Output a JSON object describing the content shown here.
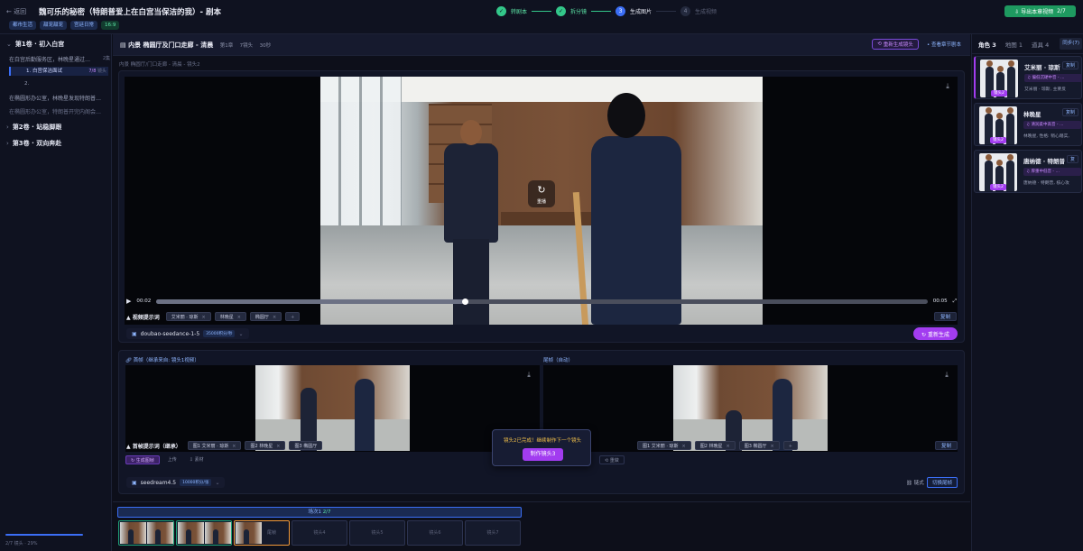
{
  "header": {
    "back_label": "← 返回",
    "title": "魏可乐的秘密（特朗普爱上在白宫当保洁的我）- 剧本",
    "tags": [
      "都市生活",
      "甜宠甜宠",
      "宫廷日常",
      "16:9"
    ],
    "steps": [
      {
        "label": "转剧本",
        "state": "done",
        "icon": "check-icon"
      },
      {
        "label": "拆分镜",
        "state": "done",
        "icon": "check-icon"
      },
      {
        "label": "生成图片",
        "state": "active",
        "number": "3"
      },
      {
        "label": "生成视频",
        "state": "todo",
        "number": "4"
      }
    ],
    "export_label": "⇩ 导出本章视频",
    "export_count": "2/7"
  },
  "sidebar": {
    "volumes": [
      {
        "label": "第1卷 · 初入白宫",
        "expanded": true
      },
      {
        "label": "第2卷 · 站稳脚跟",
        "expanded": false
      },
      {
        "label": "第3卷 · 双向奔赴",
        "expanded": false
      }
    ],
    "episodes": [
      {
        "label": "在白宫后勤服务区，林晚星通过…",
        "count": "2集"
      },
      {
        "label": "在椭圆形办公室，林晚星发现特朗普…"
      },
      {
        "label": "在椭圆形办公室，特朗普开完内阁会…"
      }
    ],
    "subitems": [
      {
        "label": "1. 白宫保洁面试",
        "count_done": "7/8",
        "count_label": "镜头",
        "selected": true
      },
      {
        "label": "2.",
        "selected": false
      }
    ],
    "progress_text": "2/7 镜头 · 29%"
  },
  "scene": {
    "title": "内景 椭圆厅及门口走廊 - 清晨",
    "meta": [
      "第1章",
      "7镜头",
      "30秒"
    ],
    "regen_all_label": "重新生成镜头",
    "view_script_label": "• 查看章节剧本",
    "breadcrumb": "内景 椭圆厅/门口走廊 - 清晨 - 镜头2"
  },
  "video": {
    "replay_label": "重播",
    "current_time": "00:02",
    "duration": "00:05",
    "progress": 0.4,
    "prompt_label": "视频提示词",
    "chips": [
      "艾米丽 · 琼斯",
      "林晚星",
      "椭圆厅"
    ],
    "copy_label": "复制",
    "model": "doubao-seedance-1-5",
    "model_price": "35000积分/秒",
    "regen_label": "↻ 重新生成"
  },
  "frames": {
    "first_label": "首帧（继承来自: 镜头1视频）",
    "last_label": "尾帧（自动）",
    "first_prompt_label": "首帧提示词（继承）",
    "first_chips": [
      "图1 艾米丽 · 琼斯",
      "图2 林晚星",
      "图3 椭圆厅"
    ],
    "last_chips": [
      "图1 艾米丽 · 琼斯",
      "图2 林晚星",
      "图3 椭圆厅"
    ],
    "copy_label": "复制",
    "action_buttons": [
      "↻ 生成图帧",
      "上传",
      "⇩ 素材"
    ],
    "reset_label": "⟲ 重做",
    "model": "seedream4.5",
    "model_price": "10000积分/张",
    "link_label": "链式",
    "switch_label": "切换尾帧"
  },
  "toast": {
    "message": "镜头2已完成！继续制作下一个镜头",
    "button": "制作镜头3"
  },
  "timeline": {
    "group_label": "场次1",
    "group_count": "2/7",
    "items": [
      {
        "label": "镜头1",
        "state": "done"
      },
      {
        "label": "镜头2",
        "state": "done"
      },
      {
        "label": "镜头3",
        "state": "current",
        "sub": "尾帧"
      },
      {
        "label": "镜头4",
        "state": "todo"
      },
      {
        "label": "镜头5",
        "state": "todo"
      },
      {
        "label": "镜头6",
        "state": "todo"
      },
      {
        "label": "镜头7",
        "state": "todo"
      }
    ]
  },
  "right": {
    "tabs": [
      {
        "label": "角色",
        "count": "3",
        "active": true
      },
      {
        "label": "地图",
        "count": "1",
        "active": false
      },
      {
        "label": "道具",
        "count": "4",
        "active": false
      }
    ],
    "sync_label": "同步(7)",
    "characters": [
      {
        "name": "艾米丽 · 琼斯",
        "voice": "♫ 偏低沉硬中音 - …",
        "desc": "艾米丽 · 琼斯, 主要反",
        "badge": "镜头2",
        "copy": "复制"
      },
      {
        "name": "林晚星",
        "voice": "♫ 清润柔中高音 - …",
        "desc": "林晚星, 性格: 稍心踏实,",
        "badge": "镜头2",
        "copy": "复制"
      },
      {
        "name": "唐纳德 · 特朗普",
        "voice": "♫ 厚重中低音 - …",
        "desc": "唐纳德 · 特朗普, 核心攻",
        "badge": "镜头2",
        "copy": "复"
      }
    ]
  }
}
